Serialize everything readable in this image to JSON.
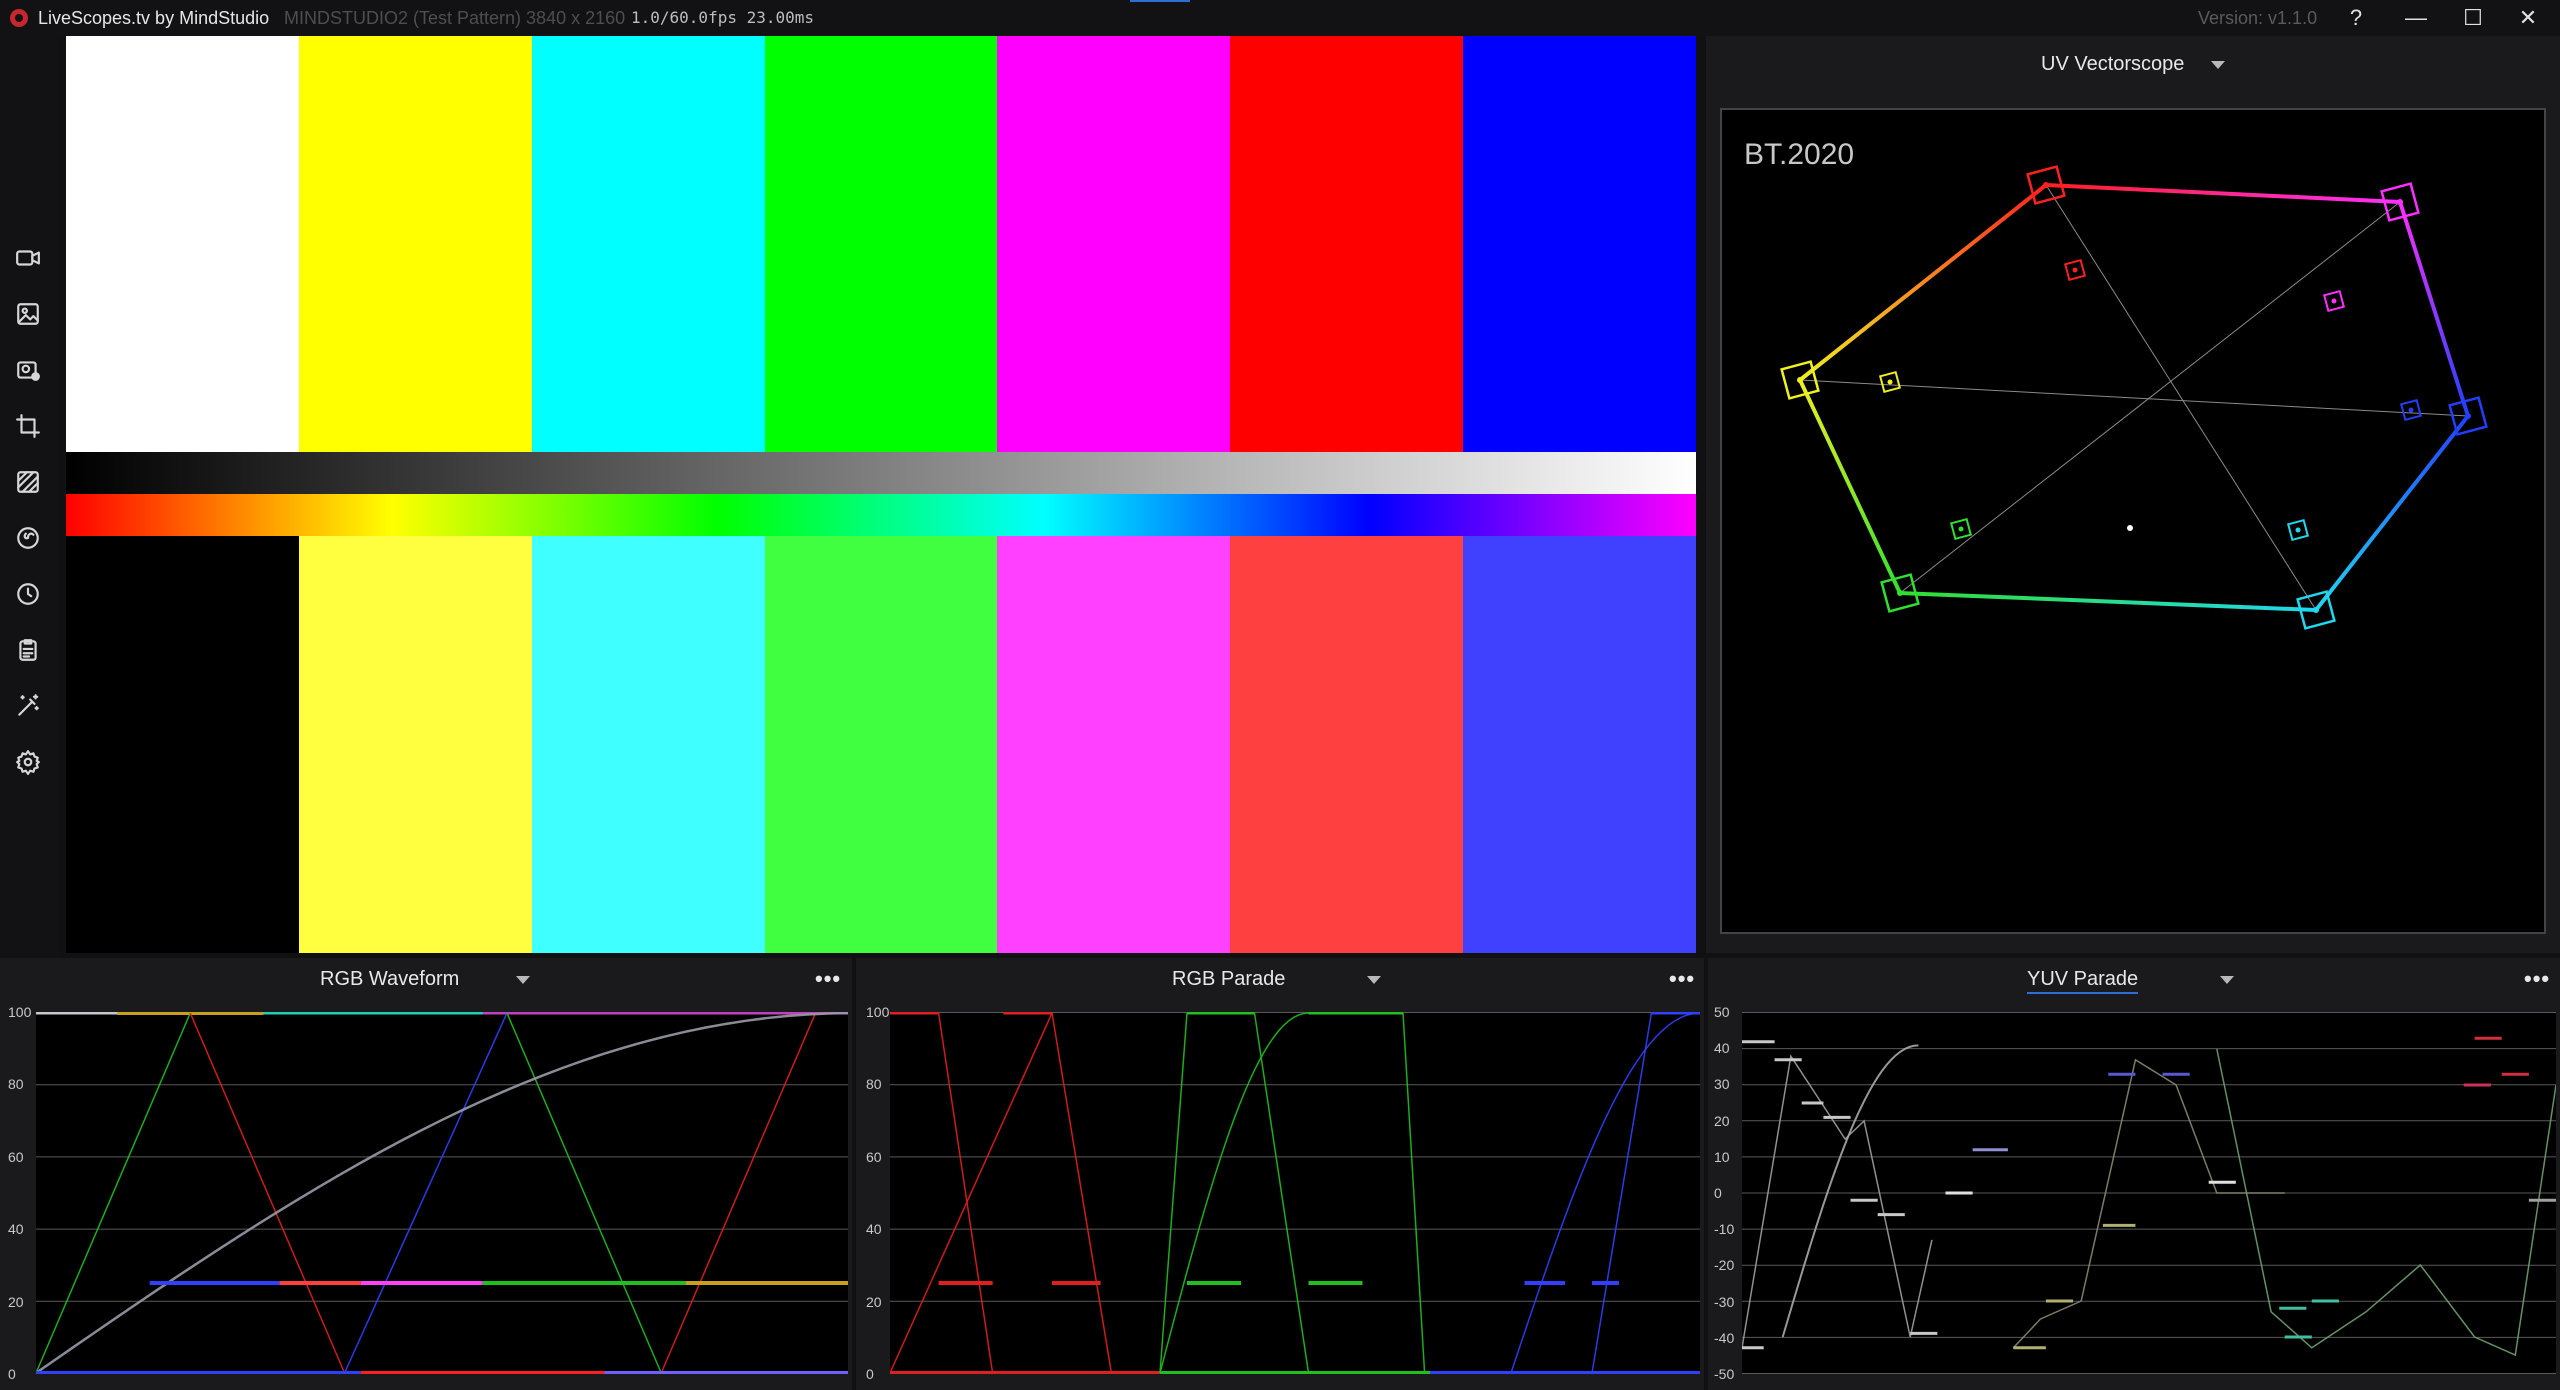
{
  "titlebar": {
    "app_name": "LiveScopes.tv by MindStudio",
    "source_info": "MINDSTUDIO2 (Test Pattern) 3840 x 2160",
    "fps_info": "1.0/60.0fps 23.00ms",
    "version": "Version: v1.1.0",
    "help_label": "?",
    "min_label": "—",
    "max_label": "☐",
    "close_label": "✕"
  },
  "sidebar": {
    "items": [
      {
        "name": "video-camera-icon"
      },
      {
        "name": "image-icon"
      },
      {
        "name": "image-capture-icon"
      },
      {
        "name": "crop-icon"
      },
      {
        "name": "pattern-icon"
      },
      {
        "name": "color-wheel-icon"
      },
      {
        "name": "history-clock-icon"
      },
      {
        "name": "clipboard-icon"
      },
      {
        "name": "magic-wand-icon"
      },
      {
        "name": "settings-gear-icon"
      }
    ]
  },
  "viewer": {
    "top_bars": [
      "#ffffff",
      "#ffff00",
      "#00ffff",
      "#00ff00",
      "#ff00ff",
      "#ff0000",
      "#0000ff"
    ],
    "bottom_bars": [
      "#000000",
      "#ffff40",
      "#40ffff",
      "#40ff40",
      "#ff40ff",
      "#ff4040",
      "#4040ff"
    ]
  },
  "vectorscope": {
    "title": "UV Vectorscope",
    "gamut_label": "BT.2020"
  },
  "waveform": {
    "title": "RGB Waveform",
    "more_label": "•••",
    "y_ticks": [
      "100",
      "80",
      "60",
      "40",
      "20",
      "0"
    ]
  },
  "parade": {
    "title": "RGB Parade",
    "more_label": "•••",
    "y_ticks": [
      "100",
      "80",
      "60",
      "40",
      "20",
      "0"
    ]
  },
  "yuv": {
    "title": "YUV Parade",
    "more_label": "•••",
    "y_ticks": [
      "50",
      "40",
      "30",
      "20",
      "10",
      "0",
      "-10",
      "-20",
      "-30",
      "-40",
      "-50"
    ]
  }
}
